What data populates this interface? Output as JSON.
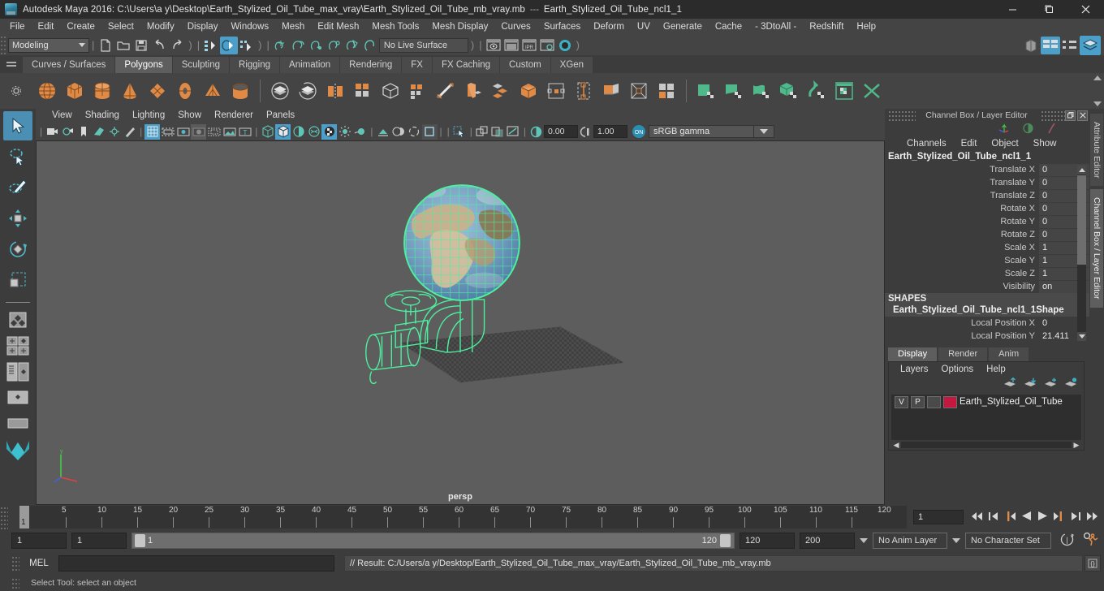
{
  "window": {
    "title": "Autodesk Maya 2016: C:\\Users\\a y\\Desktop\\Earth_Stylized_Oil_Tube_max_vray\\Earth_Stylized_Oil_Tube_mb_vray.mb",
    "separator": "---",
    "subtitle": "Earth_Stylized_Oil_Tube_ncl1_1",
    "minimize": "—",
    "maximize": "❐",
    "close": "✕"
  },
  "menubar": [
    "File",
    "Edit",
    "Create",
    "Select",
    "Modify",
    "Display",
    "Windows",
    "Mesh",
    "Edit Mesh",
    "Mesh Tools",
    "Mesh Display",
    "Curves",
    "Surfaces",
    "Deform",
    "UV",
    "Generate",
    "Cache",
    "- 3DtoAll -",
    "Redshift",
    "Help"
  ],
  "statusline": {
    "mode_menu": "Modeling",
    "live_surface": "No Live Surface",
    "icons": [
      "new-scene-icon",
      "open-scene-icon",
      "save-scene-icon",
      "undo-icon",
      "redo-icon",
      "select-by-hierarchy-icon",
      "select-by-object-icon",
      "select-by-component-icon",
      "snap-to-grid-icon",
      "snap-to-curve-icon",
      "snap-to-point-icon",
      "snap-to-projected-center-icon",
      "snap-to-view-plane-icon",
      "make-live-icon",
      "render-current-frame-icon",
      "render-sequence-icon",
      "ipr-render-icon",
      "render-settings-icon",
      "hypershade-icon",
      "open-outliner-icon",
      "open-node-editor-icon",
      "open-hypergraph-icon",
      "toggle-layer-editor-icon"
    ]
  },
  "shelf": {
    "tabs": [
      "Curves / Surfaces",
      "Polygons",
      "Sculpting",
      "Rigging",
      "Animation",
      "Rendering",
      "FX",
      "FX Caching",
      "Custom",
      "XGen"
    ],
    "active_tab": "Polygons",
    "items": [
      "polysphere-icon",
      "polycube-icon",
      "polycylinder-icon",
      "polycone-icon",
      "polyplane-icon",
      "polytorus-icon",
      "polypyramid-icon",
      "polypipe-icon",
      "boolean-union-icon",
      "boolean-difference-icon",
      "combine-icon",
      "multi-cut-icon",
      "smooth-icon",
      "quad-draw-icon",
      "sculpt-tool-icon",
      "extrude-icon",
      "bevel-icon",
      "bridge-icon",
      "merge-icon",
      "append-polygon-icon",
      "insert-edge-loop-icon",
      "offset-edge-loop-icon",
      "mirror-icon",
      "uv-editor-icon",
      "uv-planar-icon",
      "uv-cylindrical-icon",
      "uv-automatic-icon",
      "uv-unfold-icon",
      "uv-snapshot-icon",
      "uv-cut-icon"
    ]
  },
  "toolbox": [
    "select-tool",
    "lasso-select-tool",
    "paint-select-tool",
    "move-tool",
    "rotate-tool",
    "scale-tool",
    "last-tool-used",
    "layout-four-view",
    "layout-single-persp",
    "layout-outliner-persp",
    "layout-hypergraph-persp",
    "layout-persp-graph",
    "maya-logo"
  ],
  "viewport": {
    "menus": [
      "View",
      "Shading",
      "Lighting",
      "Show",
      "Renderer",
      "Panels"
    ],
    "camera_label": "persp",
    "exposure": "0.00",
    "gamma": "1.00",
    "color_management": "sRGB gamma",
    "cm_toggle": "ON",
    "icons": [
      "camera-select-icon",
      "camera-attributes-icon",
      "bookmark-icon",
      "image-plane-icon",
      "two-d-pan-zoom-icon",
      "grease-pencil-icon",
      "grid-icon",
      "film-gate-icon",
      "resolution-gate-icon",
      "gate-mask-icon",
      "film-origin-icon",
      "safe-action-icon",
      "safe-title-icon",
      "wireframe-icon",
      "smooth-shade-icon",
      "shaded-wireframe-icon",
      "textured-icon",
      "use-all-lights-icon",
      "shadows-icon",
      "ao-icon",
      "motion-blur-icon",
      "multisample-icon",
      "depth-of-field-icon",
      "isolate-select-icon",
      "xray-icon",
      "xray-joints-icon",
      "xray-active-icon"
    ]
  },
  "channelbox": {
    "panel_title": "Channel Box / Layer Editor",
    "menus": [
      "Channels",
      "Edit",
      "Object",
      "Show"
    ],
    "object_name": "Earth_Stylized_Oil_Tube_ncl1_1",
    "attributes": [
      {
        "label": "Translate X",
        "value": "0"
      },
      {
        "label": "Translate Y",
        "value": "0"
      },
      {
        "label": "Translate Z",
        "value": "0"
      },
      {
        "label": "Rotate X",
        "value": "0"
      },
      {
        "label": "Rotate Y",
        "value": "0"
      },
      {
        "label": "Rotate Z",
        "value": "0"
      },
      {
        "label": "Scale X",
        "value": "1"
      },
      {
        "label": "Scale Y",
        "value": "1"
      },
      {
        "label": "Scale Z",
        "value": "1"
      },
      {
        "label": "Visibility",
        "value": "on"
      }
    ],
    "shapes_header": "SHAPES",
    "shape_name": "Earth_Stylized_Oil_Tube_ncl1_1Shape",
    "shape_attributes": [
      {
        "label": "Local Position X",
        "value": "0"
      },
      {
        "label": "Local Position Y",
        "value": "21.411"
      }
    ]
  },
  "layereditor": {
    "tabs": [
      "Display",
      "Render",
      "Anim"
    ],
    "active_tab": "Display",
    "menus": [
      "Layers",
      "Options",
      "Help"
    ],
    "buttons": [
      "move-layer-up-icon",
      "move-layer-down-icon",
      "create-new-layer-icon",
      "create-layer-from-selected-icon"
    ],
    "layers": [
      {
        "visibility": "V",
        "playback": "P",
        "type": "",
        "color": "#c41840",
        "name": "Earth_Stylized_Oil_Tube"
      }
    ]
  },
  "vertical_tabs": [
    "Attribute Editor",
    "Channel Box / Layer Editor"
  ],
  "timeline": {
    "ticks": [
      5,
      10,
      15,
      20,
      25,
      30,
      35,
      40,
      45,
      50,
      55,
      60,
      65,
      70,
      75,
      80,
      85,
      90,
      95,
      100,
      105,
      110,
      115,
      120
    ],
    "current_frame_marker": "1",
    "current_frame_field": "1",
    "playback_buttons": [
      "go-to-start-icon",
      "step-back-keyframe-icon",
      "step-back-frame-icon",
      "play-backwards-icon",
      "play-forwards-icon",
      "step-forward-frame-icon",
      "step-forward-keyframe-icon",
      "go-to-end-icon"
    ]
  },
  "rangeslider": {
    "anim_start": "1",
    "range_start": "1",
    "bar_start": "1",
    "bar_end": "120",
    "range_end": "120",
    "anim_end": "200",
    "anim_layer": "No Anim Layer",
    "character_set": "No Character Set",
    "auto_key_icon": "auto-keyframe-icon",
    "prefs_icon": "animation-preferences-icon"
  },
  "commandline": {
    "language": "MEL",
    "input_value": "",
    "result_text": "// Result: C:/Users/a y/Desktop/Earth_Stylized_Oil_Tube_max_vray/Earth_Stylized_Oil_Tube_mb_vray.mb",
    "script_editor_icon": "script-editor-icon"
  },
  "helpline": {
    "text": "Select Tool: select an object"
  },
  "colors": {
    "accent": "#4b9fc9",
    "shelf_orange": "#e08a46",
    "shelf_green": "#4fb98c",
    "wireframe_green": "#4cf0a0",
    "layer_swatch": "#c41840"
  }
}
